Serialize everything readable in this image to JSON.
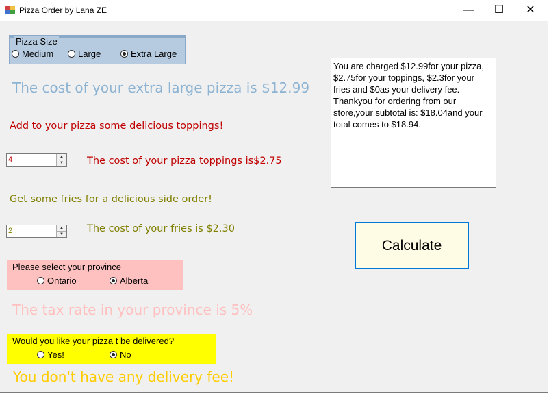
{
  "window": {
    "title": "Pizza Order by Lana ZE",
    "minimize": "—",
    "maximize": "☐",
    "close": "✕"
  },
  "colors": {
    "pizza_group": "#8aa8c8",
    "pizza_cost": "#8db3d3",
    "toppings_text": "#c00000",
    "fries_text": "#808000",
    "province_group": "#ffc0c0",
    "tax_text": "#ffc0c0",
    "delivery_group": "#ffff00",
    "delivery_text": "#ffcc00",
    "calc_border": "#0078d7"
  },
  "pizza_size": {
    "legend": "Pizza Size",
    "options": [
      {
        "label": "Medium",
        "selected": false
      },
      {
        "label": "Large",
        "selected": false
      },
      {
        "label": "Extra Large",
        "selected": true
      }
    ]
  },
  "pizza_cost_text": "The cost of your extra large pizza is $12.99",
  "toppings": {
    "prompt": "Add to your pizza some delicious toppings!",
    "value": "4",
    "cost_text": "The cost of your pizza toppings is$2.75"
  },
  "fries": {
    "prompt": "Get some fries for a delicious side order!",
    "value": "2",
    "cost_text": "The cost of your fries is $2.30"
  },
  "province": {
    "legend": "Please select your province",
    "options": [
      {
        "label": "Ontario",
        "selected": false
      },
      {
        "label": "Alberta",
        "selected": true
      }
    ]
  },
  "tax_text": "The tax rate in your province is 5%",
  "delivery": {
    "legend": "Would you like your pizza t be delivered?",
    "options": [
      {
        "label": "Yes!",
        "selected": false
      },
      {
        "label": "No",
        "selected": true
      }
    ]
  },
  "delivery_text": "You don't have any delivery fee!",
  "summary": "You are charged $12.99for your pizza, $2.75for your toppings, $2.3for your fries and $0as your delivery fee. Thankyou for ordering from our store,your subtotal is: $18.04and your total comes to $18.94.",
  "calculate_label": "Calculate"
}
